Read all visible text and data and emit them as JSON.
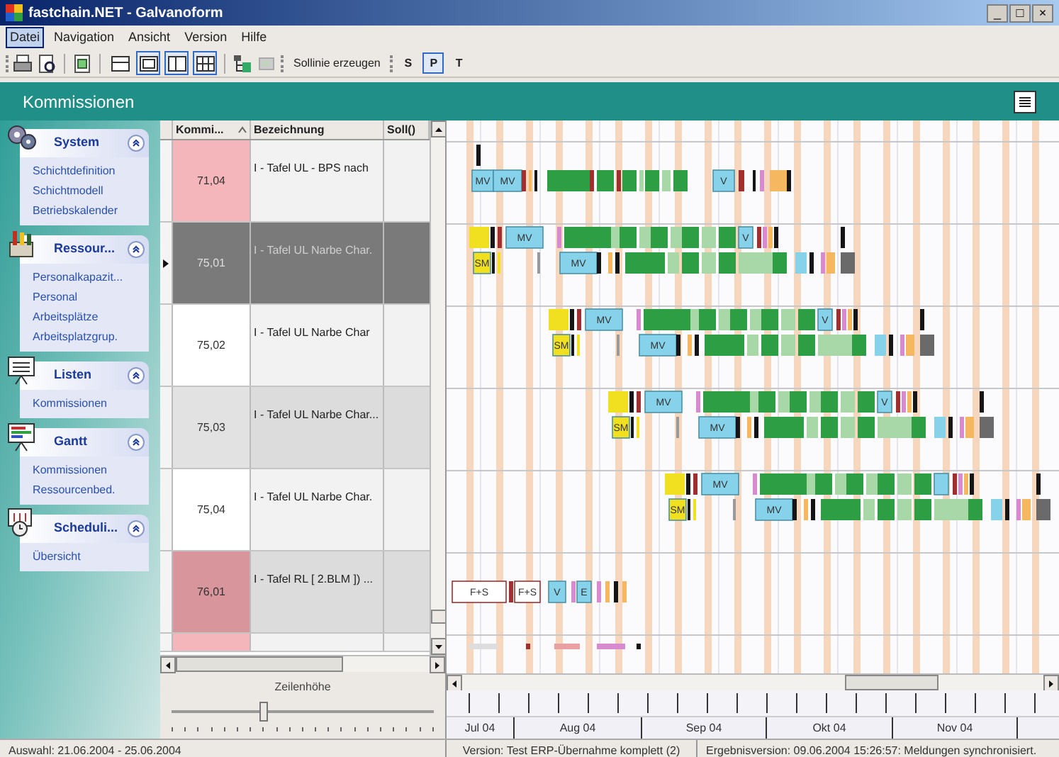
{
  "window": {
    "title": "fastchain.NET - Galvanoform",
    "controls": [
      "_",
      "□",
      "×"
    ]
  },
  "menu": [
    {
      "label": "Datei",
      "selected": true
    },
    {
      "label": "Navigation",
      "selected": false
    },
    {
      "label": "Ansicht",
      "selected": false
    },
    {
      "label": "Version",
      "selected": false
    },
    {
      "label": "Hilfe",
      "selected": false
    }
  ],
  "toolbar": {
    "view_buttons": [
      {
        "selected": false
      },
      {
        "selected": true
      },
      {
        "selected": true
      },
      {
        "selected": true
      }
    ],
    "command": "Sollinie erzeugen",
    "toggles": [
      {
        "label": "S",
        "selected": false
      },
      {
        "label": "P",
        "selected": true
      },
      {
        "label": "T",
        "selected": false
      }
    ]
  },
  "header": {
    "title": "Kommissionen"
  },
  "sidebar": {
    "groups": [
      {
        "title": "System",
        "expanded": true,
        "items": [
          "Schichtdefinition",
          "Schichtmodell",
          "Betriebskalender"
        ]
      },
      {
        "title": "Ressour...",
        "expanded": true,
        "items": [
          "Personalkapazit...",
          "Personal",
          "Arbeitsplätze",
          "Arbeitsplatzgrup."
        ]
      },
      {
        "title": "Listen",
        "expanded": true,
        "items": [
          "Kommissionen"
        ]
      },
      {
        "title": "Gantt",
        "expanded": true,
        "items": [
          "Kommissionen",
          "Ressourcenbed."
        ]
      },
      {
        "title": "Scheduli...",
        "expanded": true,
        "items": [
          "Übersicht"
        ]
      }
    ]
  },
  "grid": {
    "columns": [
      {
        "label": "Kommi...",
        "sorted": true
      },
      {
        "label": "Bezeichnung",
        "sorted": false
      },
      {
        "label": "Soll()",
        "sorted": false
      }
    ],
    "rows": [
      {
        "kommission": "71,04",
        "bezeichnung": "I - Tafel UL - BPS nach",
        "color": "#f4b6ba",
        "selected": false
      },
      {
        "kommission": "75,01",
        "bezeichnung": "I - Tafel UL Narbe Char.",
        "selected": true
      },
      {
        "kommission": "75,02",
        "bezeichnung": "I - Tafel UL Narbe Char",
        "color": "#ffffff",
        "selected": false
      },
      {
        "kommission": "75,03",
        "bezeichnung": "I - Tafel UL Narbe Char...",
        "color": "#e2e2e2",
        "selected": false
      },
      {
        "kommission": "75,04",
        "bezeichnung": "I - Tafel UL Narbe Char.",
        "color": "#ffffff",
        "selected": false
      },
      {
        "kommission": "76,01",
        "bezeichnung": "I - Tafel RL [ 2.BLM ]) ...",
        "color": "#d9959c",
        "selected": false
      },
      {
        "color": "#f4b6ba",
        "selected": false
      }
    ]
  },
  "row_height": {
    "label": "Zeilenhöhe",
    "level": 0.37
  },
  "gantt": {
    "rows": [
      {
        "labels": [
          "MV",
          "MV",
          "V"
        ]
      },
      {
        "labels": [
          "MV",
          "SM",
          "MV",
          "V"
        ]
      },
      {
        "labels": [
          "MV",
          "SM",
          "MV",
          "V"
        ]
      },
      {
        "labels": [
          "MV",
          "SM",
          "MV",
          "V"
        ]
      },
      {
        "labels": [
          "MV",
          "SM",
          "MV"
        ]
      },
      {
        "labels": [
          "F+S",
          "F+S",
          "V",
          "E"
        ]
      }
    ],
    "months": [
      "Jul 04",
      "Aug 04",
      "Sep 04",
      "Okt 04",
      "Nov 04"
    ]
  },
  "status_bar": [
    "Auswahl: 21.06.2004 - 25.06.2004",
    "Version: Test ERP-Übernahme komplett (2)",
    "Ergebnisversion: 09.06.2004 15:26:57: Meldungen synchronisiert."
  ]
}
